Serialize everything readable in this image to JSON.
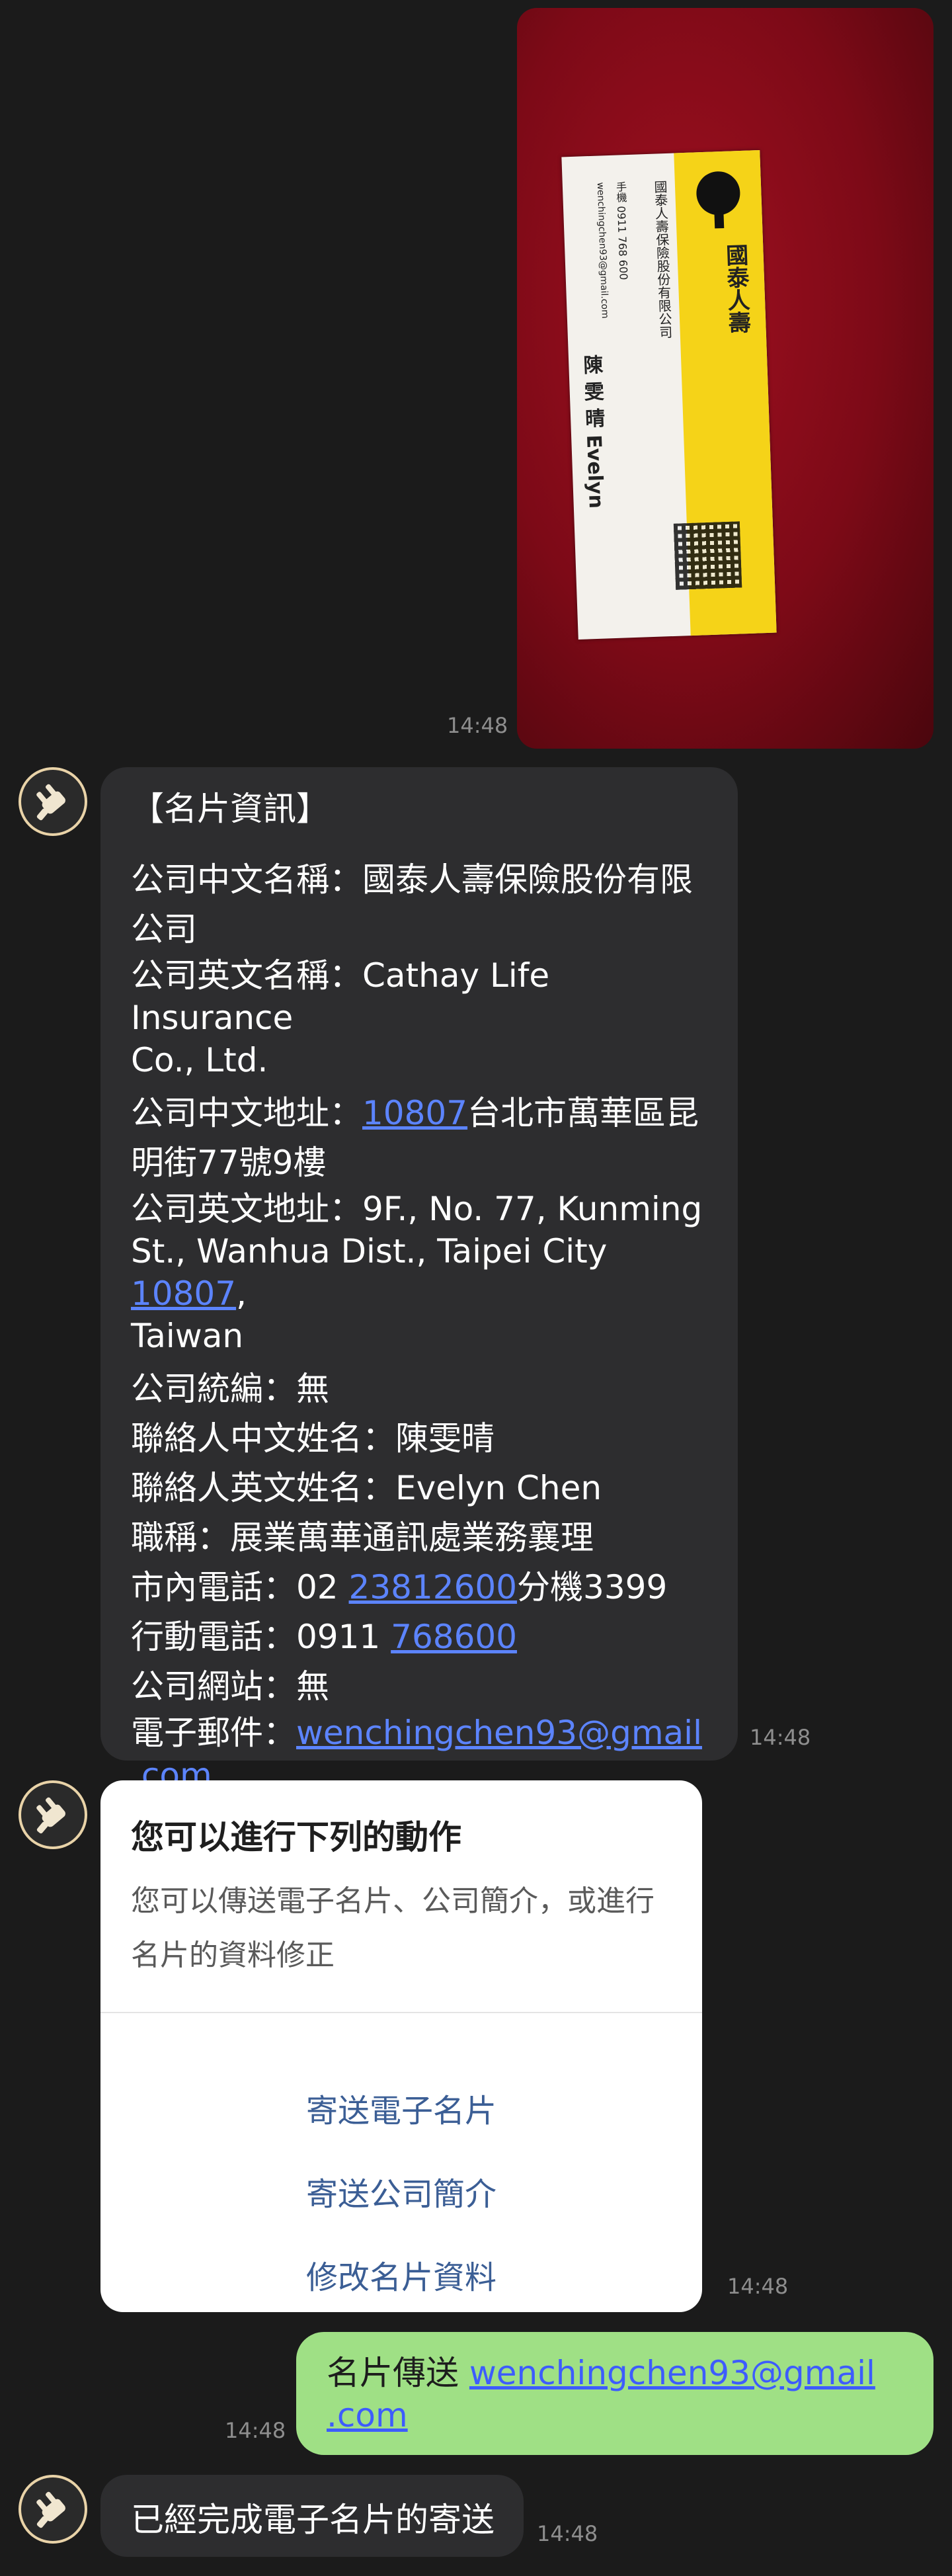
{
  "messages": {
    "photo": {
      "time": "14:48",
      "card": {
        "company_cn": "國泰人壽",
        "subtitle": "國泰人壽保險股份有限公司",
        "name": "陳 雯 晴 Evelyn",
        "phone_line": "手機 0911 768 600",
        "email": "wenchingchen93@gmail.com"
      }
    },
    "info": {
      "time": "14:48",
      "lines": {
        "heading": "【名片資訊】",
        "company_cn_label": "公司中文名稱：國泰人壽保險股份有限",
        "company_cn_cont": "公司",
        "company_en_label": "公司英文名稱：Cathay Life Insurance",
        "company_en_cont": "Co., Ltd.",
        "addr_cn_prefix": "公司中文地址：",
        "addr_cn_zip": "10807",
        "addr_cn_rest": "台北市萬華區昆",
        "addr_cn_cont": "明街77號9樓",
        "addr_en_label": "公司英文地址：9F., No. 77, Kunming",
        "addr_en_prefix": "St., Wanhua Dist., Taipei City ",
        "addr_en_zip": "10807",
        "addr_en_comma": ",",
        "addr_en_cont": "Taiwan",
        "tax_id": "公司統編：無",
        "contact_cn": "聯絡人中文姓名：陳雯晴",
        "contact_en": "聯絡人英文姓名：Evelyn Chen",
        "title": "職稱：展業萬華通訊處業務襄理",
        "tel_prefix": "市內電話：02 ",
        "tel_number": "23812600",
        "tel_ext": "分機3399",
        "mobile_prefix": "行動電話：0911 ",
        "mobile_number": "768600",
        "website": "公司網站：無",
        "email_prefix": "電子郵件：",
        "email_part1": "wenchingchen93@gmail",
        "email_part2": ".com"
      }
    },
    "actions": {
      "time": "14:48",
      "title": "您可以進行下列的動作",
      "desc": "您可以傳送電子名片、公司簡介，或進行名片的資料修正",
      "buttons": [
        "寄送電子名片",
        "寄送公司簡介",
        "修改名片資料"
      ]
    },
    "user_reply": {
      "time": "14:48",
      "text_prefix": "名片傳送 ",
      "link_part1": "wenchingchen93@gmail",
      "link_part2": ".com"
    },
    "bot_confirm": {
      "time": "14:48",
      "text": "已經完成電子名片的寄送"
    }
  },
  "colors": {
    "background": "#1b1b1b",
    "bubble_dark": "#2d2d2f",
    "bubble_green": "#9fe085",
    "link": "#5c84ff",
    "action_button": "#3b5e95"
  }
}
